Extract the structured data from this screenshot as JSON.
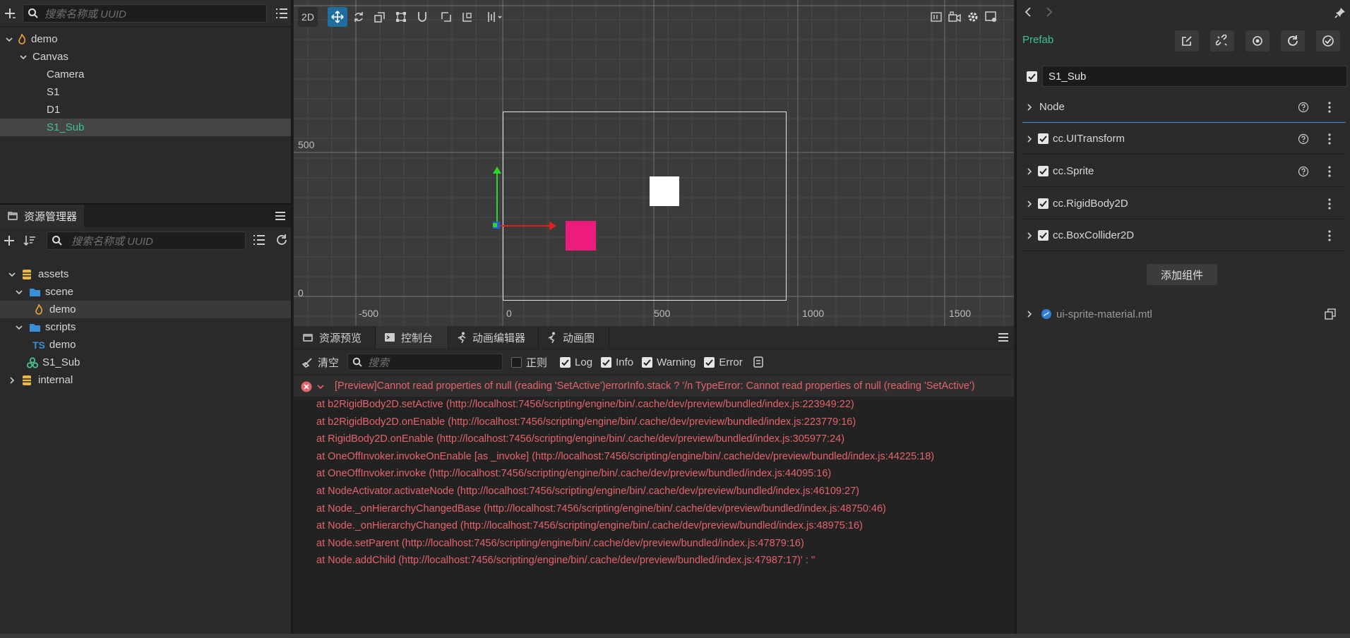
{
  "hierarchy": {
    "search_placeholder": "搜索名称或 UUID",
    "items": [
      {
        "label": "demo"
      },
      {
        "label": "Canvas"
      },
      {
        "label": "Camera"
      },
      {
        "label": "S1"
      },
      {
        "label": "D1"
      },
      {
        "label": "S1_Sub"
      }
    ]
  },
  "assets": {
    "tab_label": "资源管理器",
    "search_placeholder": "搜索名称或 UUID",
    "items": [
      {
        "label": "assets"
      },
      {
        "label": "scene"
      },
      {
        "label": "demo"
      },
      {
        "label": "scripts"
      },
      {
        "label": "demo",
        "badge": "TS"
      },
      {
        "label": "S1_Sub"
      },
      {
        "label": "internal"
      }
    ]
  },
  "scene": {
    "mode_2d": "2D",
    "axis": {
      "x_labels": [
        "-500",
        "0",
        "500",
        "1000",
        "1500"
      ],
      "y_labels": [
        "500",
        "0"
      ]
    }
  },
  "console": {
    "tabs": [
      {
        "label": "资源预览"
      },
      {
        "label": "控制台"
      },
      {
        "label": "动画编辑器"
      },
      {
        "label": "动画图"
      }
    ],
    "clear_label": "清空",
    "search_placeholder": "搜索",
    "filters": [
      {
        "label": "正则",
        "checked": false
      },
      {
        "label": "Log",
        "checked": true
      },
      {
        "label": "Info",
        "checked": true
      },
      {
        "label": "Warning",
        "checked": true
      },
      {
        "label": "Error",
        "checked": true
      }
    ],
    "error_title": "[Preview]Cannot read properties of null (reading 'SetActive')errorInfo.stack ? '/n TypeError: Cannot read properties of null (reading 'SetActive')",
    "stack": [
      "at b2RigidBody2D.setActive (http://localhost:7456/scripting/engine/bin/.cache/dev/preview/bundled/index.js:223949:22)",
      "at b2RigidBody2D.onEnable (http://localhost:7456/scripting/engine/bin/.cache/dev/preview/bundled/index.js:223779:16)",
      "at RigidBody2D.onEnable (http://localhost:7456/scripting/engine/bin/.cache/dev/preview/bundled/index.js:305977:24)",
      "at OneOffInvoker.invokeOnEnable [as _invoke] (http://localhost:7456/scripting/engine/bin/.cache/dev/preview/bundled/index.js:44225:18)",
      "at OneOffInvoker.invoke (http://localhost:7456/scripting/engine/bin/.cache/dev/preview/bundled/index.js:44095:16)",
      "at NodeActivator.activateNode (http://localhost:7456/scripting/engine/bin/.cache/dev/preview/bundled/index.js:46109:27)",
      "at Node._onHierarchyChangedBase (http://localhost:7456/scripting/engine/bin/.cache/dev/preview/bundled/index.js:48750:46)",
      "at Node._onHierarchyChanged (http://localhost:7456/scripting/engine/bin/.cache/dev/preview/bundled/index.js:48975:16)",
      "at Node.setParent (http://localhost:7456/scripting/engine/bin/.cache/dev/preview/bundled/index.js:47879:16)",
      "at Node.addChild (http://localhost:7456/scripting/engine/bin/.cache/dev/preview/bundled/index.js:47987:17)' : ''"
    ]
  },
  "inspector": {
    "prefab_label": "Prefab",
    "node_name": "S1_Sub",
    "node_section": "Node",
    "components": [
      {
        "label": "cc.UITransform",
        "help": true
      },
      {
        "label": "cc.Sprite",
        "help": true
      },
      {
        "label": "cc.RigidBody2D",
        "help": false
      },
      {
        "label": "cc.BoxCollider2D",
        "help": false
      }
    ],
    "add_component_label": "添加组件",
    "material_label": "ui-sprite-material.mtl"
  },
  "colors": {
    "accent_green": "#3fc28f",
    "error_red": "#e5646b",
    "sprite_pink": "#ec1b7c",
    "active_blue": "#1e6fa0"
  }
}
